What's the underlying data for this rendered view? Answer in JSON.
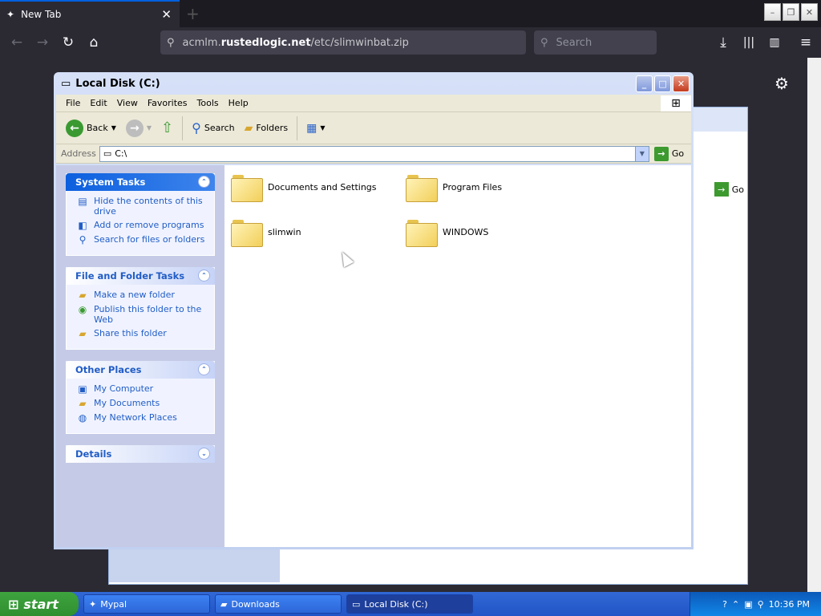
{
  "browser": {
    "tab_title": "New Tab",
    "url_prefix": "acmlm.",
    "url_domain": "rustedlogic.net",
    "url_path": "/etc/slimwinbat.zip",
    "search_placeholder": "Search"
  },
  "explorer": {
    "title": "Local Disk (C:)",
    "menu": [
      "File",
      "Edit",
      "View",
      "Favorites",
      "Tools",
      "Help"
    ],
    "toolbar": {
      "back": "Back",
      "search": "Search",
      "folders": "Folders"
    },
    "address_label": "Address",
    "address_value": "C:\\",
    "go_label": "Go",
    "panels": {
      "system_tasks": {
        "title": "System Tasks",
        "items": [
          "Hide the contents of this drive",
          "Add or remove programs",
          "Search for files or folders"
        ]
      },
      "file_folder_tasks": {
        "title": "File and Folder Tasks",
        "items": [
          "Make a new folder",
          "Publish this folder to the Web",
          "Share this folder"
        ]
      },
      "other_places": {
        "title": "Other Places",
        "items": [
          "My Computer",
          "My Documents",
          "My Network Places"
        ]
      },
      "details": {
        "title": "Details"
      }
    },
    "folders": [
      "Documents and Settings",
      "Program Files",
      "slimwin",
      "WINDOWS"
    ]
  },
  "back_window": {
    "go_label": "Go"
  },
  "taskbar": {
    "start_label": "start",
    "tasks": [
      "Mypal",
      "Downloads",
      "Local Disk (C:)"
    ],
    "clock": "10:36 PM"
  }
}
